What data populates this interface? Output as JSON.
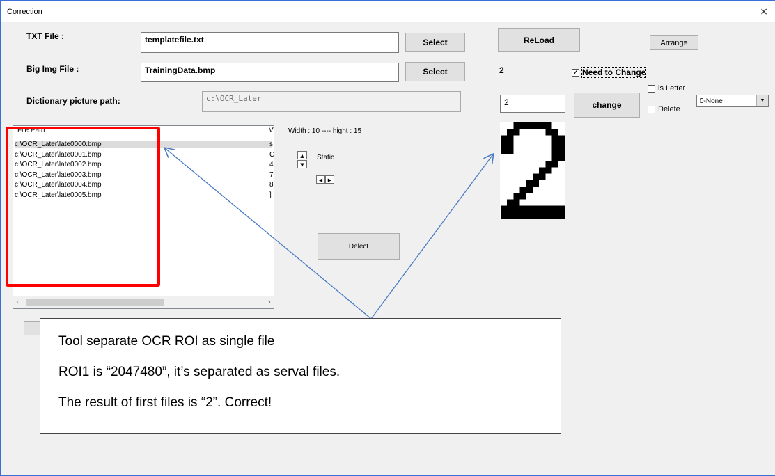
{
  "window": {
    "title": "Correction",
    "close_glyph": "×"
  },
  "txt_file": {
    "label": "TXT File :",
    "value": "templatefile.txt",
    "button": "Select"
  },
  "big_img": {
    "label": "Big Img File :",
    "value": "TrainingData.bmp",
    "button": "Select"
  },
  "dict_path": {
    "label": "Dictionary picture path:",
    "value": "c:\\OCR_Later"
  },
  "reload_button": "ReLoad",
  "arrange_button": "Arrange",
  "current_value": "2",
  "need_to_change": {
    "label": "Need to Change",
    "checked": true
  },
  "change_input": "2",
  "change_button": "change",
  "is_letter": {
    "label": "is Letter",
    "checked": false
  },
  "delete": {
    "label": "Delete",
    "checked": false
  },
  "type_select": {
    "value": "0-None"
  },
  "list": {
    "headers": [
      "File Path",
      "V"
    ],
    "rows": [
      {
        "path": "c:\\OCR_Later\\late0000.bmp",
        "v": "s"
      },
      {
        "path": "c:\\OCR_Later\\late0001.bmp",
        "v": "C"
      },
      {
        "path": "c:\\OCR_Later\\late0002.bmp",
        "v": "4"
      },
      {
        "path": "c:\\OCR_Later\\late0003.bmp",
        "v": "7"
      },
      {
        "path": "c:\\OCR_Later\\late0004.bmp",
        "v": "8"
      },
      {
        "path": "c:\\OCR_Later\\late0005.bmp",
        "v": "]"
      }
    ]
  },
  "dimensions_text": "Width : 10 ---- hight : 15",
  "static_label": "Static",
  "detect_button": "Delect",
  "preview_glyph": "2",
  "callout": {
    "line1": "Tool separate OCR ROI as single file",
    "line2": "ROI1 is “2047480”, it’s separated as serval files.",
    "line3": "The result of first files is “2”. Correct!"
  },
  "colors": {
    "highlight": "#ff0000",
    "arrow": "#4a7bc4",
    "window_border": "#3b6fd8"
  }
}
